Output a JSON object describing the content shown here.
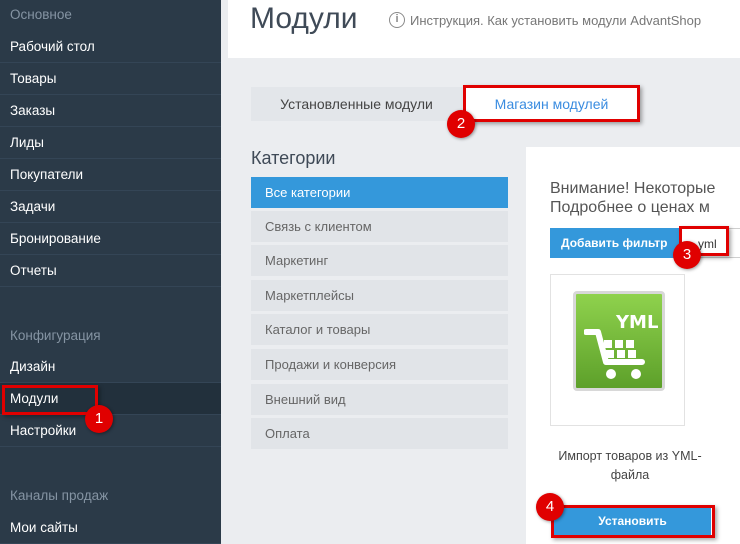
{
  "sidebar": {
    "groups": [
      "Основное",
      "Конфигурация",
      "Каналы продаж"
    ],
    "main_items": [
      "Рабочий стол",
      "Товары",
      "Заказы",
      "Лиды",
      "Покупатели",
      "Задачи",
      "Бронирование",
      "Отчеты"
    ],
    "config_items": [
      "Дизайн",
      "Модули",
      "Настройки"
    ],
    "channel_items": [
      "Мои сайты"
    ],
    "active_item": "Модули"
  },
  "header": {
    "title": "Модули",
    "help_icon": "info-circle-icon",
    "help_link": "Инструкция. Как установить модули AdvantShop"
  },
  "tabs": [
    {
      "label": "Установленные модули",
      "active": false
    },
    {
      "label": "Магазин модулей",
      "active": true
    }
  ],
  "categories": {
    "heading": "Категории",
    "items": [
      "Все категории",
      "Связь с клиентом",
      "Маркетинг",
      "Маркетплейсы",
      "Каталог и товары",
      "Продажи и конверсия",
      "Внешний вид",
      "Оплата"
    ],
    "active": "Все категории"
  },
  "panel": {
    "notice_line1": "Внимание! Некоторые",
    "notice_line2": "Подробнее о ценах м",
    "filter_button": "Добавить фильтр",
    "filter_value": "yml",
    "module": {
      "logo_text": "YML",
      "logo_icon": "shopping-cart-icon",
      "name": "Импорт товаров из YML-файла",
      "install_button": "Установить"
    }
  },
  "callouts": [
    "1",
    "2",
    "3",
    "4"
  ],
  "colors": {
    "accent": "#3498db",
    "sidebar": "#2b3a48",
    "highlight": "#e00000"
  }
}
